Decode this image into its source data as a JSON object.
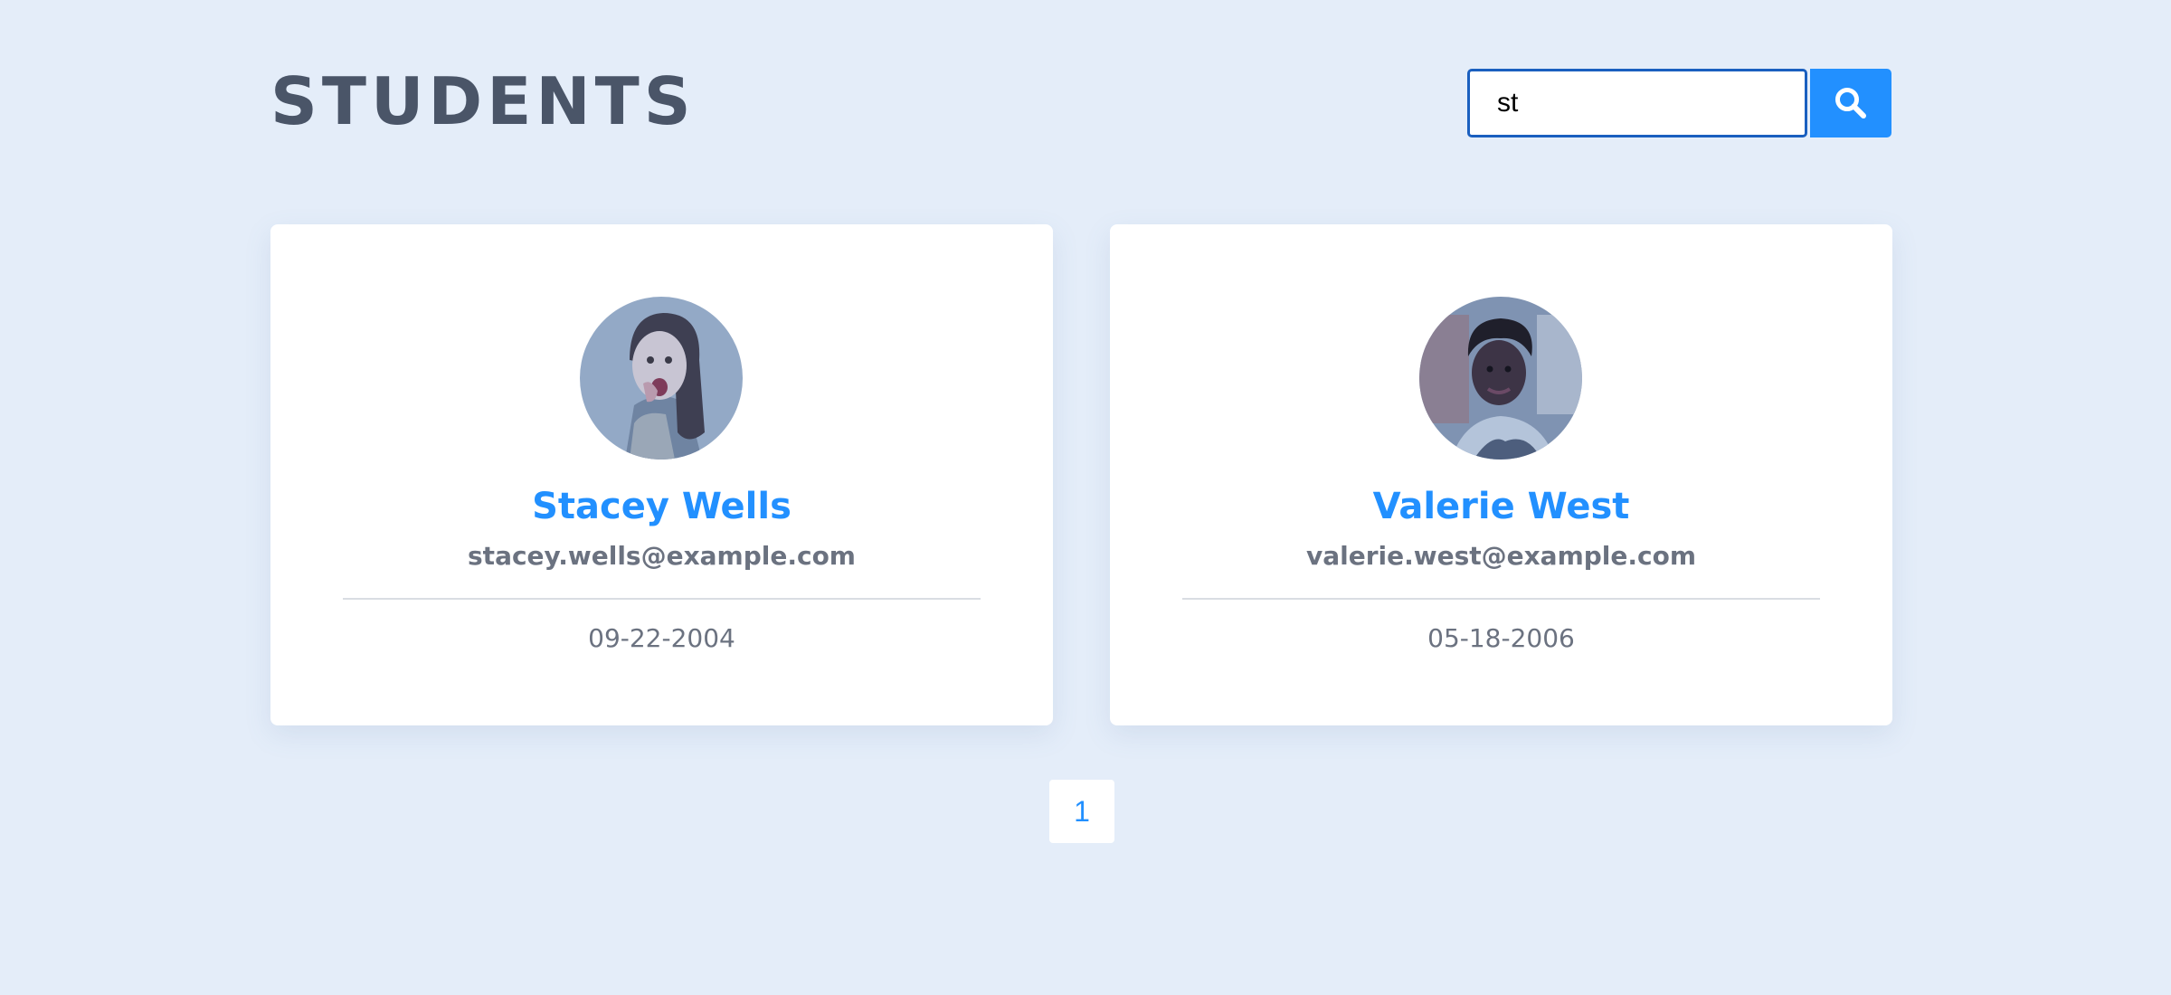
{
  "header": {
    "title": "STUDENTS"
  },
  "search": {
    "value": "st",
    "icon": "search-icon"
  },
  "students": [
    {
      "name": "Stacey Wells",
      "email": "stacey.wells@example.com",
      "dob": "09-22-2004"
    },
    {
      "name": "Valerie West",
      "email": "valerie.west@example.com",
      "dob": "05-18-2006"
    }
  ],
  "pagination": {
    "pages": [
      "1"
    ]
  },
  "colors": {
    "background": "#e4edf9",
    "accent": "#2290ff",
    "title": "#4a5568",
    "muted_text": "#6b7280"
  }
}
